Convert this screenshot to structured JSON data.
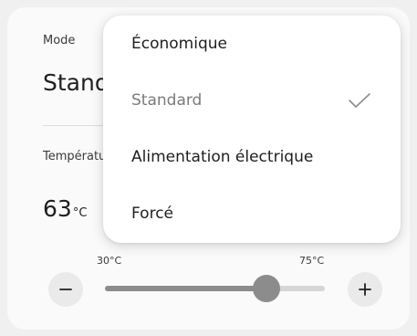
{
  "mode": {
    "label": "Mode",
    "value": "Standard"
  },
  "temperature": {
    "label": "Température",
    "value": "63",
    "unit": "°C",
    "min_label": "30°C",
    "max_label": "75°C",
    "min": 30,
    "max": 75,
    "current": 63
  },
  "dropdown": {
    "items": [
      {
        "label": "Économique",
        "selected": false
      },
      {
        "label": "Standard",
        "selected": true
      },
      {
        "label": "Alimentation électrique",
        "selected": false
      },
      {
        "label": "Forcé",
        "selected": false
      }
    ]
  },
  "icons": {
    "minus": "minus-icon",
    "plus": "plus-icon",
    "check": "checkmark-icon"
  },
  "colors": {
    "slider_active": "#8c8c8c",
    "slider_inactive": "#d6d6d6",
    "selected_text": "#7a7a7a"
  }
}
